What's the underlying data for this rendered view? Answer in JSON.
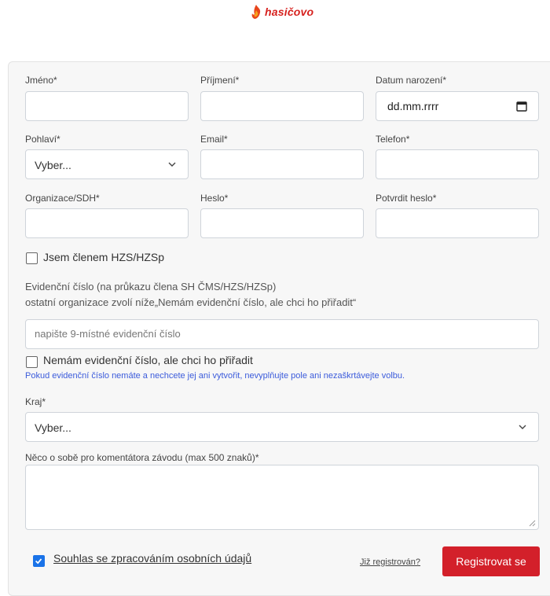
{
  "brand": {
    "name": "hasičovo"
  },
  "form": {
    "first_name": {
      "label": "Jméno*",
      "value": ""
    },
    "last_name": {
      "label": "Příjmení*",
      "value": ""
    },
    "birth_date": {
      "label": "Datum narození*",
      "value": "dd.mm.rrrr"
    },
    "gender": {
      "label": "Pohlaví*",
      "value": "Vyber..."
    },
    "email": {
      "label": "Email*",
      "value": ""
    },
    "phone": {
      "label": "Telefon*",
      "value": ""
    },
    "organization": {
      "label": "Organizace/SDH*",
      "value": ""
    },
    "password": {
      "label": "Heslo*",
      "value": ""
    },
    "password_confirm": {
      "label": "Potvrdit heslo*",
      "value": ""
    },
    "member_checkbox": {
      "label": "Jsem členem HZS/HZSp",
      "checked": false
    },
    "evidence": {
      "line1": "Evidenční číslo (na průkazu člena SH ČMS/HZS/HZSp)",
      "line2": "ostatní organizace zvolí níže„Nemám evidenční číslo, ale chci ho přiřadit“",
      "placeholder": "napište 9-místné evidenční číslo"
    },
    "no_evidence_checkbox": {
      "label": "Nemám evidenční číslo, ale chci ho přiřadit",
      "checked": false
    },
    "evidence_help": "Pokud evidenční číslo nemáte a nechcete jej ani vytvořit, nevyplňujte pole ani nezaškrtávejte volbu.",
    "region": {
      "label": "Kraj*",
      "value": "Vyber..."
    },
    "about": {
      "label": "Něco o sobě pro komentátora závodu (max 500 znaků)*",
      "value": ""
    },
    "consent": {
      "label": "Souhlas se zpracováním osobních údajů",
      "checked": true
    },
    "already_registered": "Již registrován?",
    "submit": "Registrovat se"
  },
  "colors": {
    "accent": "#d3202a",
    "brand": "#d6201d",
    "checkbox": "#1a73e8",
    "help": "#3b5bdb"
  }
}
